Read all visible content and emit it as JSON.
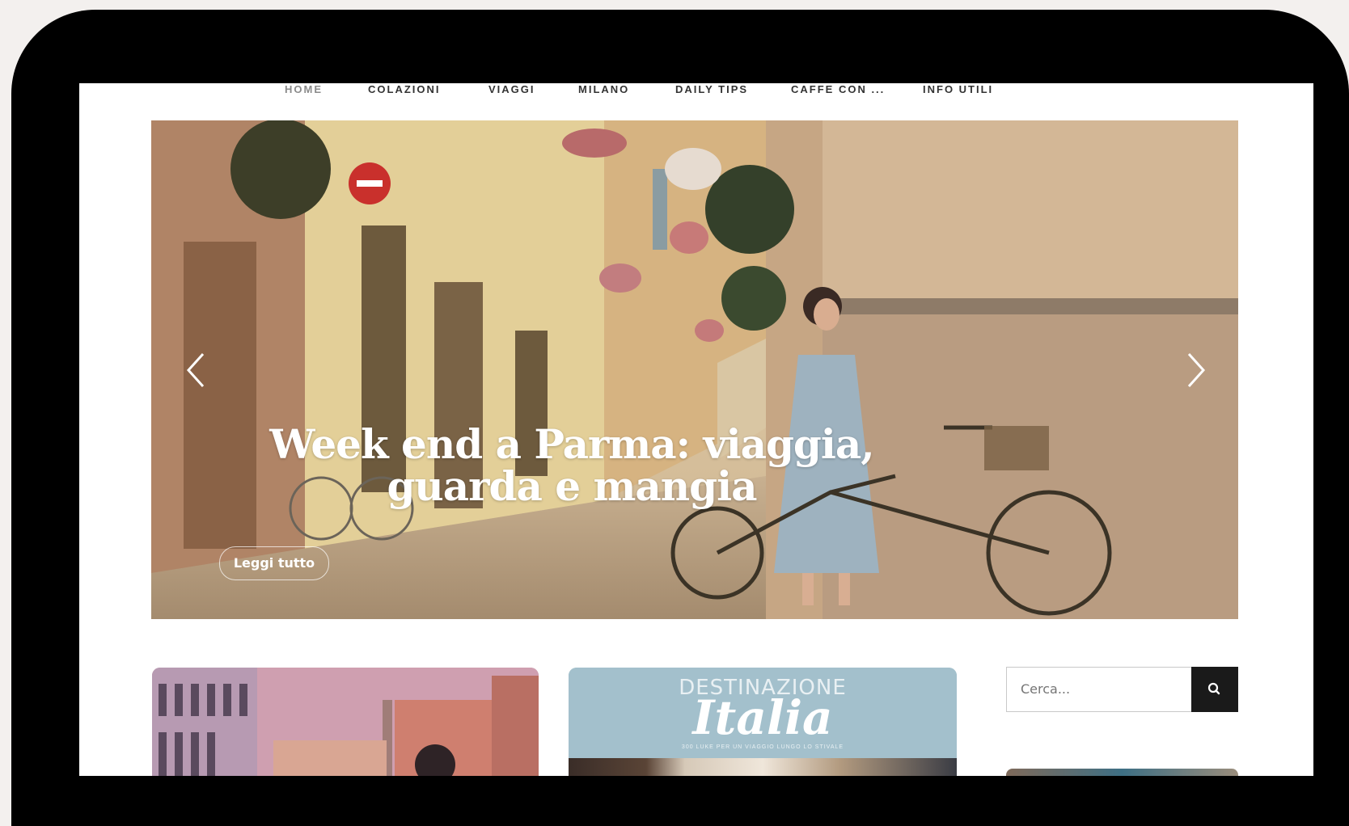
{
  "nav": {
    "items": [
      {
        "label": "HOME",
        "active": true
      },
      {
        "label": "COLAZIONI",
        "active": false
      },
      {
        "label": "VIAGGI",
        "active": false
      },
      {
        "label": "MILANO",
        "active": false
      },
      {
        "label": "DAILY TIPS",
        "active": false
      },
      {
        "label": "CAFFE CON ...",
        "active": false
      },
      {
        "label": "INFO UTILI",
        "active": false
      }
    ]
  },
  "hero": {
    "title_line1": "Week end a Parma: viaggia,",
    "title_line2": "guarda e mangia",
    "button_label": "Leggi tutto",
    "prev_icon": "chevron-left-icon",
    "next_icon": "chevron-right-icon"
  },
  "cards": {
    "italia": {
      "top_text": "DESTINAZIONE",
      "title": "Italia",
      "subtitle": "300 LUKE PER UN VIAGGIO LUNGO LO STIVALE"
    }
  },
  "sidebar": {
    "search_placeholder": "Cerca...",
    "search_icon": "search-icon"
  },
  "colors": {
    "nav_text": "#333333",
    "nav_active": "#8a8a8a",
    "search_button": "#1a1a1a",
    "device_frame": "#000000"
  }
}
